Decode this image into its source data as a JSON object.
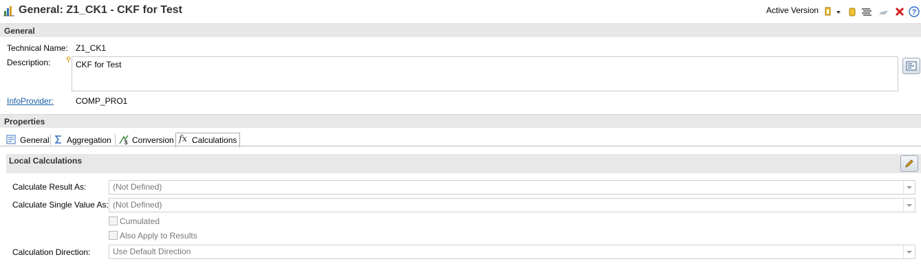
{
  "window": {
    "title": "General: Z1_CK1 - CKF for Test",
    "active_version": "Active Version"
  },
  "general": {
    "section_title": "General",
    "technical_name_label": "Technical Name:",
    "technical_name_value": "Z1_CK1",
    "description_label": "Description:",
    "description_value": "CKF for Test",
    "infoprovider_label": "InfoProvider:",
    "infoprovider_value": "COMP_PRO1"
  },
  "properties": {
    "section_title": "Properties",
    "tabs": [
      {
        "label": "General",
        "icon": "general-tab-icon"
      },
      {
        "label": "Aggregation",
        "icon": "sigma-icon"
      },
      {
        "label": "Conversion",
        "icon": "conversion-icon"
      },
      {
        "label": "Calculations",
        "icon": "fx-icon"
      }
    ],
    "active_tab": "Calculations"
  },
  "local_calculations": {
    "title": "Local Calculations",
    "calculate_result_as_label": "Calculate Result As:",
    "calculate_result_as_value": "(Not Defined)",
    "calculate_single_value_as_label": "Calculate Single Value As:",
    "calculate_single_value_as_value": "(Not Defined)",
    "cumulated_label": "Cumulated",
    "cumulated_checked": false,
    "also_apply_label": "Also Apply to Results",
    "also_apply_checked": false,
    "calculation_direction_label": "Calculation Direction:",
    "calculation_direction_value": "Use Default Direction"
  },
  "colors": {
    "link": "#1a5ea8",
    "section_bg": "#e8e8e8",
    "close_red": "#d0201a"
  }
}
